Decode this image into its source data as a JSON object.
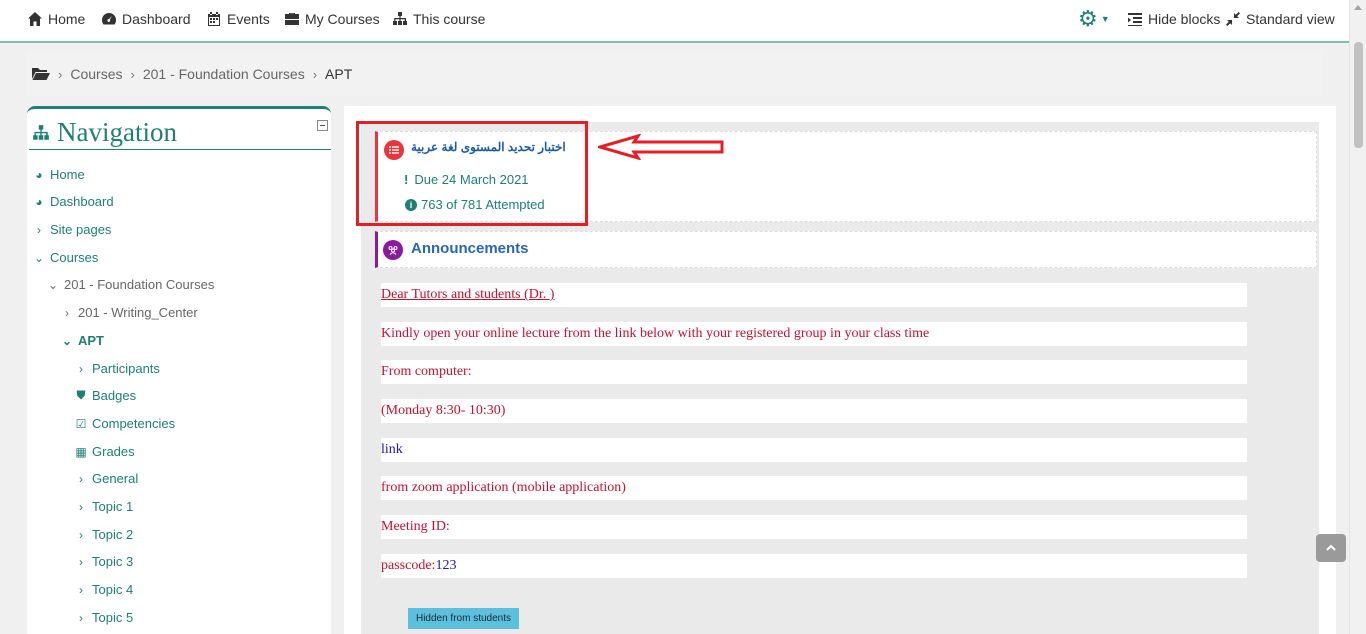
{
  "topnav": {
    "home": "Home",
    "dashboard": "Dashboard",
    "events": "Events",
    "my_courses": "My Courses",
    "this_course": "This course",
    "hide_blocks": "Hide blocks",
    "standard_view": "Standard view"
  },
  "breadcrumb": {
    "items": [
      "Courses",
      "201 - Foundation Courses",
      "APT"
    ]
  },
  "navigation": {
    "title": "Navigation",
    "items": [
      {
        "label": "Home"
      },
      {
        "label": "Dashboard"
      },
      {
        "label": "Site pages"
      },
      {
        "label": "Courses"
      },
      {
        "label": "201 - Foundation Courses"
      },
      {
        "label": "201 - Writing_Center"
      },
      {
        "label": "APT"
      },
      {
        "label": "Participants"
      },
      {
        "label": "Badges"
      },
      {
        "label": "Competencies"
      },
      {
        "label": "Grades"
      },
      {
        "label": "General"
      },
      {
        "label": "Topic 1"
      },
      {
        "label": "Topic 2"
      },
      {
        "label": "Topic 3"
      },
      {
        "label": "Topic 4"
      },
      {
        "label": "Topic 5"
      }
    ]
  },
  "quiz": {
    "title": "اختبار تحديد المستوى لغة عربية",
    "due": "Due 24 March 2021",
    "attempted": "763 of 781 Attempted"
  },
  "announcements": {
    "title": "Announcements"
  },
  "labels": {
    "line1": "Dear Tutors and students (Dr. )",
    "line2": "Kindly open your online lecture from the link below with your registered group in your class time",
    "line3": "From computer:",
    "line4": "(Monday 8:30- 10:30)",
    "line5": "link",
    "line6": "from zoom application (mobile application)",
    "line7": "Meeting ID:",
    "line8_prefix": "passcode:",
    "line8_value": "123"
  },
  "badge": {
    "hidden": "Hidden from students"
  },
  "colors": {
    "accent": "#1f7f75",
    "highlight": "#e51d24",
    "label_red": "#c8102e",
    "link_blue": "#1a1aa6"
  }
}
